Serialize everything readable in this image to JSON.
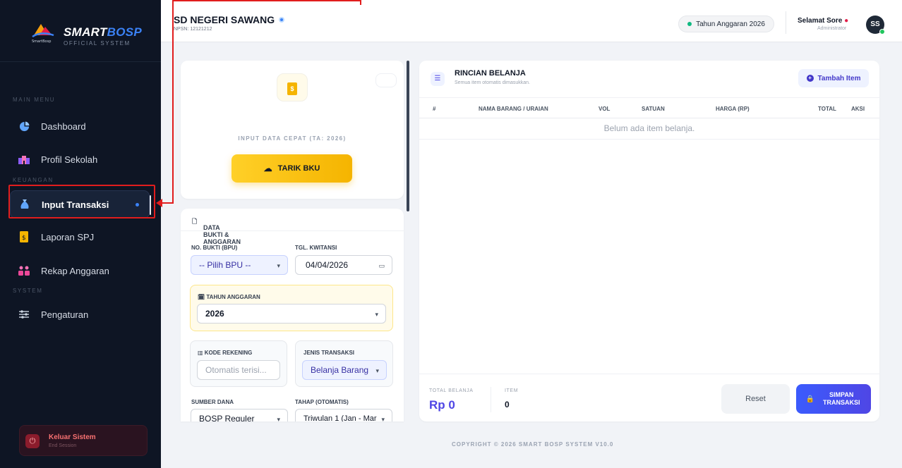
{
  "brand": {
    "name_main": "SMART",
    "name_accent": "BOSP",
    "tagline": "OFFICIAL SYSTEM",
    "logo_text": "SmartBosp"
  },
  "sidebar": {
    "section_main": "MAIN MENU",
    "section_keuangan": "KEUANGAN",
    "section_system": "SYSTEM",
    "items": [
      {
        "label": "Dashboard",
        "icon": "pie-chart-icon"
      },
      {
        "label": "Profil Sekolah",
        "icon": "school-icon"
      },
      {
        "label": "Input Transaksi",
        "icon": "money-bag-icon",
        "active": true
      },
      {
        "label": "Laporan SPJ",
        "icon": "file-invoice-icon"
      },
      {
        "label": "Rekap Anggaran",
        "icon": "people-icon"
      },
      {
        "label": "Pengaturan",
        "icon": "sliders-icon"
      }
    ],
    "logout": {
      "title": "Keluar Sistem",
      "subtitle": "End Session"
    }
  },
  "topbar": {
    "school": "SD NEGERI SAWANG",
    "npsn": "NPSN: 12121212",
    "year_pill": "Tahun Anggaran 2026",
    "greeting": "Selamat Sore",
    "role": "Administrator",
    "avatar": "SS"
  },
  "quick": {
    "title": "INPUT DATA CEPAT (TA: 2026)",
    "button": "TARIK BKU"
  },
  "form": {
    "header": "DATA BUKTI & ANGGARAN",
    "no_bukti_label": "NO. BUKTI (BPU)",
    "no_bukti_value": "-- Pilih BPU --",
    "tgl_label": "TGL. KWITANSI",
    "tgl_value": "04/04/2026",
    "tahun_label": "TAHUN ANGGARAN",
    "tahun_value": "2026",
    "kode_label": "KODE REKENING",
    "kode_placeholder": "Otomatis terisi...",
    "jenis_label": "JENIS TRANSAKSI",
    "jenis_value": "Belanja Barang",
    "sumber_label": "SUMBER DANA",
    "sumber_value": "BOSP Reguler",
    "tahap_label": "TAHAP (OTOMATIS)",
    "tahap_value": "Triwulan 1 (Jan - Mar"
  },
  "rincian": {
    "title": "RINCIAN BELANJA",
    "subtitle": "Semua item otomatis dimasukkan.",
    "add_button": "Tambah Item",
    "columns": [
      "#",
      "NAMA BARANG / URAIAN",
      "VOL",
      "SATUAN",
      "HARGA (RP)",
      "TOTAL",
      "AKSI"
    ],
    "empty": "Belum ada item belanja.",
    "total_label": "TOTAL BELANJA",
    "total_value": "Rp 0",
    "item_label": "ITEM",
    "item_value": "0",
    "reset": "Reset",
    "save_line1": "SIMPAN",
    "save_line2": "TRANSAKSI"
  },
  "footer": {
    "copyright": "COPYRIGHT © 2026 SMART BOSP SYSTEM V10.0"
  },
  "colors": {
    "accent": "#4f46e5",
    "warning": "#f5b400",
    "annotation": "#e11d1d",
    "sidebar": "#0e1524"
  }
}
